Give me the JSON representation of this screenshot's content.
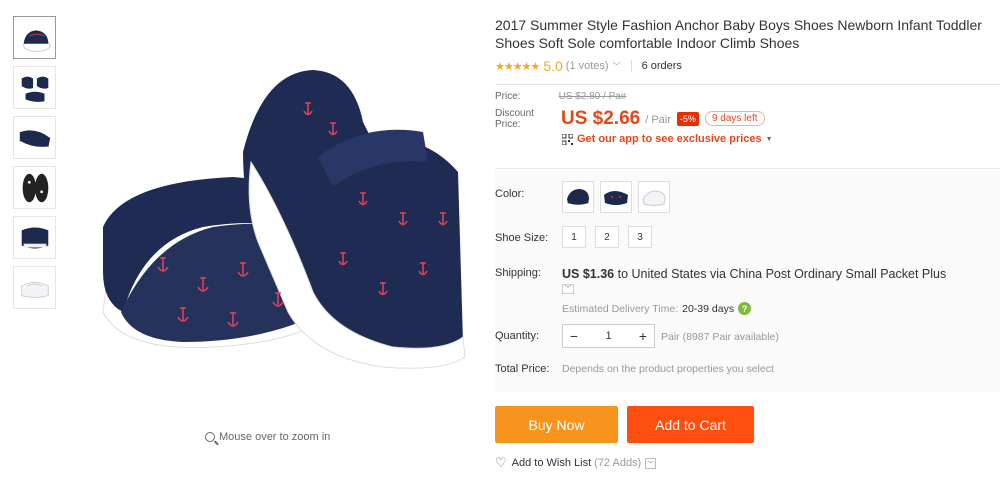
{
  "product": {
    "title": "2017 Summer Style Fashion Anchor Baby Boys Shoes Newborn Infant Toddler Shoes Soft Sole comfortable Indoor Climb Shoes",
    "stars": "★★★★★",
    "score": "5.0",
    "votes": "(1 votes)",
    "orders": "6 orders"
  },
  "gallery": {
    "thumbnails": [
      "sandal-side",
      "sandal-pair",
      "sandal-angle",
      "sandal-soles",
      "sandal-top",
      "sandal-white"
    ],
    "zoom_hint": "Mouse over to zoom in"
  },
  "pricing": {
    "price_label": "Price:",
    "old_price": "US $2.80 / Pair",
    "discount_label_1": "Discount",
    "discount_label_2": "Price:",
    "new_price": "US $2.66",
    "unit": "/ Pair",
    "discount_pct": "-5%",
    "days_left": "9 days left",
    "app_promo": "Get our app to see exclusive prices"
  },
  "options": {
    "color_label": "Color:",
    "colors": [
      "navy-anchor",
      "navy-anchor-angle",
      "white"
    ],
    "size_label": "Shoe Size:",
    "sizes": [
      "1",
      "2",
      "3"
    ],
    "shipping_label": "Shipping:",
    "shipping_price": "US $1.36",
    "shipping_text": " to United States via China Post Ordinary Small Packet Plus",
    "delivery_label": "Estimated Delivery Time:",
    "delivery_days": "20-39 days",
    "quantity_label": "Quantity:",
    "quantity": "1",
    "availability": "Pair (8987 Pair available)",
    "total_label": "Total Price:",
    "total_note": "Depends on the product properties you select"
  },
  "actions": {
    "buy_now": "Buy Now",
    "add_to_cart": "Add to Cart",
    "wishlist": "Add to Wish List",
    "wishlist_count": "(72 Adds)"
  },
  "colors": {
    "price_red": "#e6471a",
    "buy_orange": "#f7941d",
    "cart_red": "#ff4f10",
    "star": "#f5a623"
  }
}
